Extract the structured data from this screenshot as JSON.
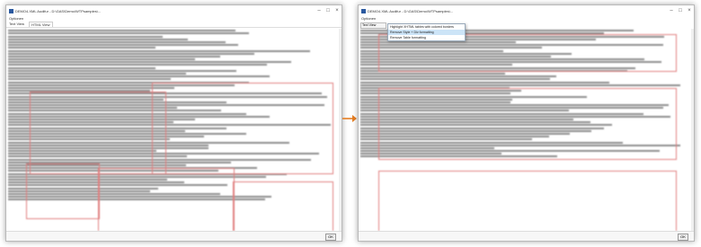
{
  "left_window": {
    "title": "DEMO4.XML Audifur - D:\\GAS\\Demo\\WTPsamples\\...",
    "menu": "Optionen",
    "tabs": [
      "Text View",
      "HTML View"
    ],
    "ok_label": "OK"
  },
  "right_window": {
    "title": "DEMO4.XML Audifur - D:\\GAS\\Demo\\WTPsamples\\...",
    "menu": "Optionen",
    "view_selector": "Text View",
    "dropdown": {
      "items": [
        "Highlight XHTML tables with colored borders",
        "Remove Style + Div formatting",
        "Remove Table formatting"
      ],
      "selected_index": 1
    },
    "ok_label": "OK"
  },
  "colors": {
    "table_border": "#e07d7d",
    "arrow": "#e67e22",
    "selection": "#cce4f7"
  }
}
